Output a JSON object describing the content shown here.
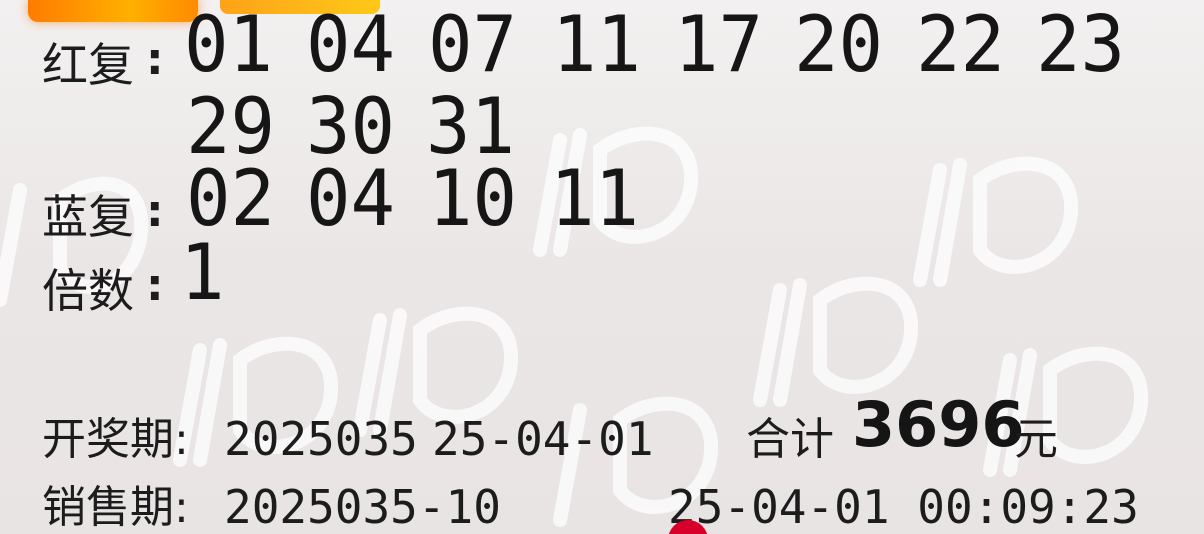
{
  "ticket": {
    "red_label": "红复",
    "red_numbers_row1": [
      "01",
      "04",
      "07",
      "11",
      "17",
      "20",
      "22",
      "23"
    ],
    "red_numbers_row2": [
      "29",
      "30",
      "31"
    ],
    "blue_label": "蓝复",
    "blue_numbers": [
      "02",
      "04",
      "10",
      "11"
    ],
    "multiple_label": "倍数",
    "multiple_value": "1",
    "colon": ":",
    "draw_label": "开奖期:",
    "draw_period": "2025035",
    "draw_date": "25-04-01",
    "total_label": "合计",
    "total_value": "3696",
    "total_unit": "元",
    "sale_label": "销售期:",
    "sale_period": "2025035-10",
    "sale_datetime": "25-04-01 00:09:23"
  },
  "colors": {
    "background": "#ece8e8",
    "text": "#1a1a1a",
    "accent_orange": "#ff8a00",
    "dot_red": "#d8002a"
  }
}
